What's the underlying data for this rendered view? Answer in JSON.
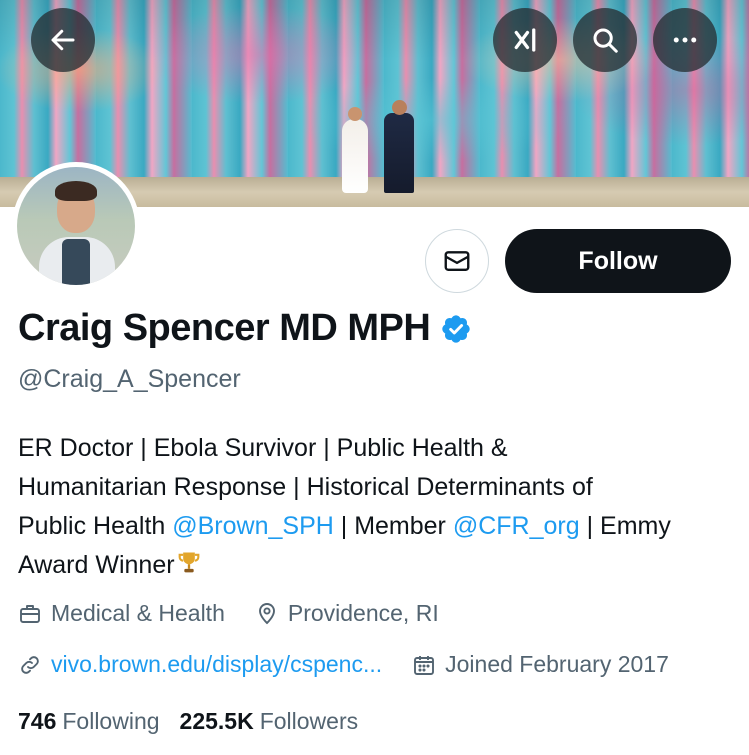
{
  "header": {
    "back_icon": "arrow-left-icon",
    "grok_icon": "grok-icon",
    "search_icon": "search-icon",
    "more_icon": "more-horizontal-icon"
  },
  "profile": {
    "display_name": "Craig Spencer MD MPH",
    "verified": true,
    "handle": "@Craig_A_Spencer",
    "follow_label": "Follow",
    "message_icon": "envelope-icon",
    "bio": {
      "line1": "ER Doctor | Ebola Survivor | Public Health &",
      "line2": "Humanitarian Response | Historical Determinants of",
      "line3_pre": "Public Health ",
      "mention1": "@Brown_SPH",
      "line3_mid": " | Member ",
      "mention2": "@CFR_org",
      "line3_post": " | Emmy",
      "line4": "Award Winner"
    },
    "category": "Medical & Health",
    "location": "Providence, RI",
    "website": "vivo.brown.edu/display/cspenc...",
    "joined": "Joined February 2017"
  },
  "stats": {
    "following_count": "746",
    "following_label": "Following",
    "followers_count": "225.5K",
    "followers_label": "Followers"
  },
  "colors": {
    "accent": "#1d9bf0",
    "text_primary": "#0f1419",
    "text_secondary": "#536471",
    "follow_bg": "#0f1419"
  }
}
